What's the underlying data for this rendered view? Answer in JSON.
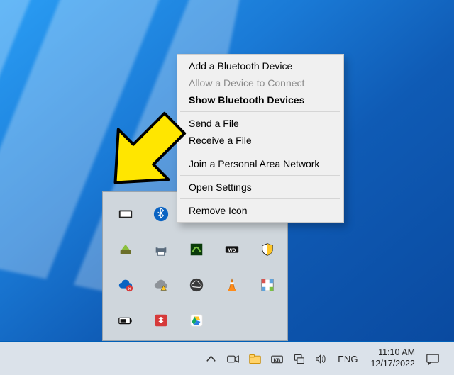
{
  "context_menu": {
    "items": [
      {
        "label": "Add a Bluetooth Device",
        "disabled": false,
        "bold": false
      },
      {
        "label": "Allow a Device to Connect",
        "disabled": true,
        "bold": false
      },
      {
        "label": "Show Bluetooth Devices",
        "disabled": false,
        "bold": true
      },
      "---",
      {
        "label": "Send a File",
        "disabled": false,
        "bold": false
      },
      {
        "label": "Receive a File",
        "disabled": false,
        "bold": false
      },
      "---",
      {
        "label": "Join a Personal Area Network",
        "disabled": false,
        "bold": false
      },
      "---",
      {
        "label": "Open Settings",
        "disabled": false,
        "bold": false
      },
      "---",
      {
        "label": "Remove Icon",
        "disabled": false,
        "bold": false
      }
    ]
  },
  "tray_flyout": {
    "icons": [
      "keyboard-ui-icon",
      "bluetooth-icon",
      "nvidia-icon",
      "double-monitor-icon",
      "",
      "eject-device-icon",
      "printer-icon",
      "nvidia-experience-icon",
      "wd-drive-icon",
      "defender-icon",
      "onedrive-error-icon",
      "cloud-warning-icon",
      "creative-cloud-icon",
      "vlc-icon",
      "pixel-app-icon",
      "battery-indicator-icon",
      "dropbox-icon",
      "google-drive-icon",
      "",
      ""
    ]
  },
  "taskbar": {
    "chevron_tip": "Show hidden icons",
    "icons": {
      "meet_now": "meet-now-icon",
      "explorer": "file-explorer-icon",
      "onscreen_kb": "touch-keyboard-icon",
      "network": "network-icon",
      "volume": "volume-icon"
    },
    "language": "ENG",
    "clock": {
      "time": "11:10 AM",
      "date": "12/17/2022"
    }
  },
  "colors": {
    "context_bg": "#f0f0f0",
    "tray_bg": "#cfd6dc",
    "taskbar_bg": "#dbe2ea",
    "pointer": "#ffe600",
    "bluetooth": "#0a63c2"
  }
}
